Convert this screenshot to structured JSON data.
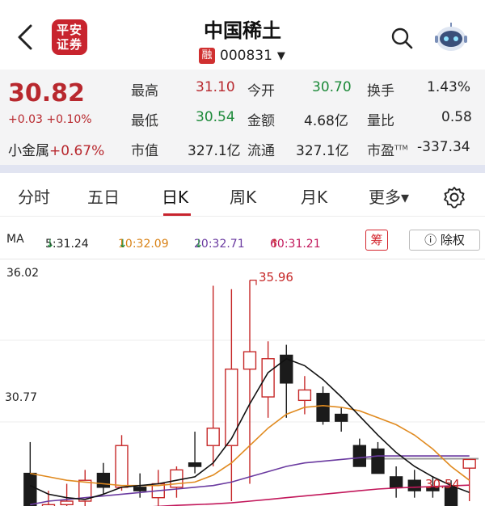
{
  "header": {
    "broker_logo_top": "平安",
    "broker_logo_bottom": "证券",
    "stock_name": "中国稀土",
    "margin_badge": "融",
    "stock_code": "000831",
    "code_caret": "▼"
  },
  "quote": {
    "price": "30.82",
    "change": "+0.03 +0.10%",
    "sector_label": "小金属",
    "sector_change": "+0.67%",
    "fields": [
      {
        "label": "最高",
        "value": "31.10",
        "color": "red"
      },
      {
        "label": "今开",
        "value": "30.70",
        "color": "green"
      },
      {
        "label": "换手",
        "value": "1.43%",
        "color": "dark"
      },
      {
        "label": "最低",
        "value": "30.54",
        "color": "green"
      },
      {
        "label": "金额",
        "value": "4.68亿",
        "color": "dark"
      },
      {
        "label": "量比",
        "value": "0.58",
        "color": "dark"
      },
      {
        "label": "市值",
        "value": "327.1亿",
        "color": "dark"
      },
      {
        "label": "流通",
        "value": "327.1亿",
        "color": "dark"
      },
      {
        "label": "市盈",
        "value": "-337.34",
        "color": "dark"
      }
    ],
    "ttm_label": "TTM"
  },
  "tabs": {
    "items": [
      "分时",
      "五日",
      "日K",
      "周K",
      "月K",
      "更多▾"
    ],
    "active_index": 2
  },
  "ma": {
    "label": "MA",
    "ma5": "5:31.24",
    "ma10": "10:32.09",
    "ma20": "20:32.71",
    "ma60": "60:31.21",
    "ma5_arrow": "↓",
    "ma10_arrow": "↓",
    "ma20_arrow": "↓",
    "ma60_arrow": "↑",
    "chou_label": "筹",
    "chuquan_label": "ⓘ 除权"
  },
  "chart_data": {
    "type": "candlestick",
    "y_max_label": "36.02",
    "y_mid_label": "30.77",
    "high_label": "35.96",
    "low_label": "30.54",
    "ylim": [
      29.6,
      36.3
    ],
    "candles": [
      {
        "o": 30.4,
        "h": 31.3,
        "l": 29.9,
        "c": 29.4
      },
      {
        "o": 29.4,
        "h": 29.9,
        "l": 29.3,
        "c": 29.5
      },
      {
        "o": 29.5,
        "h": 30.1,
        "l": 29.2,
        "c": 29.6
      },
      {
        "o": 29.6,
        "h": 30.5,
        "l": 29.4,
        "c": 30.2
      },
      {
        "o": 30.4,
        "h": 30.7,
        "l": 29.8,
        "c": 30.0
      },
      {
        "o": 30.0,
        "h": 31.5,
        "l": 29.9,
        "c": 31.2
      },
      {
        "o": 30.0,
        "h": 30.4,
        "l": 29.7,
        "c": 29.9
      },
      {
        "o": 29.7,
        "h": 30.5,
        "l": 29.3,
        "c": 30.1
      },
      {
        "o": 30.0,
        "h": 30.6,
        "l": 29.7,
        "c": 30.5
      },
      {
        "o": 30.7,
        "h": 31.6,
        "l": 30.4,
        "c": 30.6
      },
      {
        "o": 31.2,
        "h": 35.8,
        "l": 30.6,
        "c": 31.7
      },
      {
        "o": 31.2,
        "h": 35.7,
        "l": 29.6,
        "c": 33.4
      },
      {
        "o": 33.4,
        "h": 35.96,
        "l": 30.1,
        "c": 33.9
      },
      {
        "o": 32.6,
        "h": 34.2,
        "l": 32.0,
        "c": 33.7
      },
      {
        "o": 33.8,
        "h": 34.1,
        "l": 32.0,
        "c": 33.0
      },
      {
        "o": 32.5,
        "h": 33.2,
        "l": 32.1,
        "c": 32.8
      },
      {
        "o": 32.7,
        "h": 32.9,
        "l": 31.8,
        "c": 31.9
      },
      {
        "o": 32.1,
        "h": 32.3,
        "l": 31.6,
        "c": 31.9
      },
      {
        "o": 31.2,
        "h": 31.4,
        "l": 30.7,
        "c": 30.6
      },
      {
        "o": 31.1,
        "h": 31.3,
        "l": 30.9,
        "c": 30.4
      },
      {
        "o": 30.3,
        "h": 30.6,
        "l": 29.7,
        "c": 30.0
      },
      {
        "o": 30.2,
        "h": 30.5,
        "l": 29.7,
        "c": 29.9
      },
      {
        "o": 30.0,
        "h": 30.3,
        "l": 29.7,
        "c": 29.9
      },
      {
        "o": 30.0,
        "h": 30.2,
        "l": 29.1,
        "c": 29.1
      },
      {
        "o": 30.55,
        "h": 30.7,
        "l": 29.6,
        "c": 30.8
      }
    ],
    "ma5": [
      30.05,
      29.8,
      29.7,
      29.65,
      29.8,
      30.0,
      30.05,
      30.1,
      30.2,
      30.3,
      30.7,
      31.4,
      32.4,
      33.3,
      33.7,
      33.5,
      33.1,
      32.6,
      32.05,
      31.5,
      31.0,
      30.6,
      30.3,
      30.05,
      29.85
    ],
    "ma10": [
      30.4,
      30.3,
      30.2,
      30.15,
      30.1,
      30.05,
      30.05,
      30.05,
      30.1,
      30.15,
      30.35,
      30.7,
      31.2,
      31.7,
      32.1,
      32.3,
      32.35,
      32.3,
      32.2,
      32.0,
      31.8,
      31.5,
      31.1,
      30.6,
      30.2
    ],
    "ma20": [
      29.5,
      29.6,
      29.65,
      29.7,
      29.75,
      29.8,
      29.85,
      29.9,
      29.95,
      30.0,
      30.05,
      30.15,
      30.3,
      30.45,
      30.6,
      30.7,
      30.75,
      30.8,
      30.85,
      30.9,
      30.9,
      30.9,
      30.9,
      30.9,
      30.9
    ],
    "ma60": [
      29.2,
      29.25,
      29.3,
      29.35,
      29.38,
      29.4,
      29.42,
      29.45,
      29.48,
      29.5,
      29.52,
      29.55,
      29.6,
      29.65,
      29.7,
      29.75,
      29.8,
      29.85,
      29.9,
      29.95,
      29.98,
      30.0,
      30.02,
      30.04,
      30.06
    ],
    "ref_line": 30.82
  },
  "colors": {
    "up": "#c62828",
    "down": "#1b1b1b",
    "ma5": "#111111",
    "ma10": "#e08a1f",
    "ma20": "#6a3aa0",
    "ma60": "#c2185b",
    "accent": "#c8242e"
  }
}
